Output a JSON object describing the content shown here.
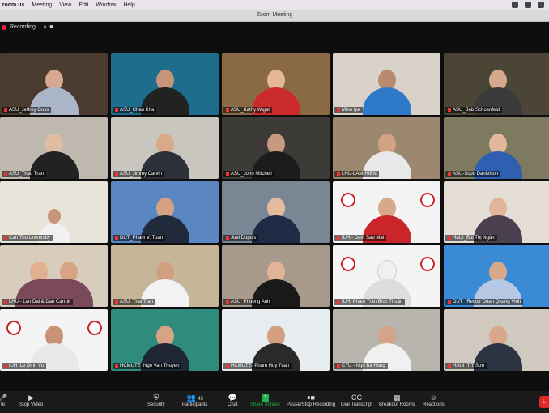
{
  "menubar": {
    "app": "zoom.us",
    "items": [
      "Meeting",
      "View",
      "Edit",
      "Window",
      "Help"
    ]
  },
  "window": {
    "title": "Zoom Meeting"
  },
  "recording": {
    "label": "Recording...",
    "pause": "⏸",
    "stop": "■"
  },
  "participants": [
    {
      "name": "ASU_Jeffrey Goss"
    },
    {
      "name": "ASU_Chau Kha"
    },
    {
      "name": "ASU_Kathy Wigal"
    },
    {
      "name": "Minu Ipe"
    },
    {
      "name": "ASU_Bob Schoenfeld"
    },
    {
      "name": "ASU_Thao Tran"
    },
    {
      "name": "ASU_Jimmy Carvin"
    },
    {
      "name": "ASU_John Mitchell"
    },
    {
      "name": "LHU-LAM-HIEN"
    },
    {
      "name": "ASU-Scott Danielson"
    },
    {
      "name": "Can Tho University"
    },
    {
      "name": "DUT_Pham V. Tuan"
    },
    {
      "name": "Joel Dupuis"
    },
    {
      "name": "IUH - Dam Sao Mai"
    },
    {
      "name": "HaUI_Bùi Thị Ngân"
    },
    {
      "name": "LHU - Lan Dai & Dan Carroll"
    },
    {
      "name": "ASU_Thai Tran"
    },
    {
      "name": "ASU_Phuong Anh"
    },
    {
      "name": "IUH_Phạm Trần Bích Thuận"
    },
    {
      "name": "DUT_ Rector Doan Quang Vinh"
    },
    {
      "name": "IUH_Le Dinh Vu"
    },
    {
      "name": "HCMUTE_Ngo Van Thuyen"
    },
    {
      "name": "HCMUTE- Pham Huy Tuan"
    },
    {
      "name": "CTU - Ngô Bá Hùng"
    },
    {
      "name": "HAUI_T T Sơn"
    }
  ],
  "toolbar": {
    "unmute": "te",
    "video": "Stop Video",
    "security": "Security",
    "participants": "Participants",
    "participants_count": "43",
    "chat": "Chat",
    "share": "Share Screen",
    "record": "Pause/Stop Recording",
    "transcript": "Live Transcript",
    "breakout": "Breakout Rooms",
    "reactions": "Reactions",
    "end": "L"
  },
  "colors": {
    "share_green": "#22b14c",
    "end_red": "#e02828",
    "record_red": "#e22233"
  }
}
